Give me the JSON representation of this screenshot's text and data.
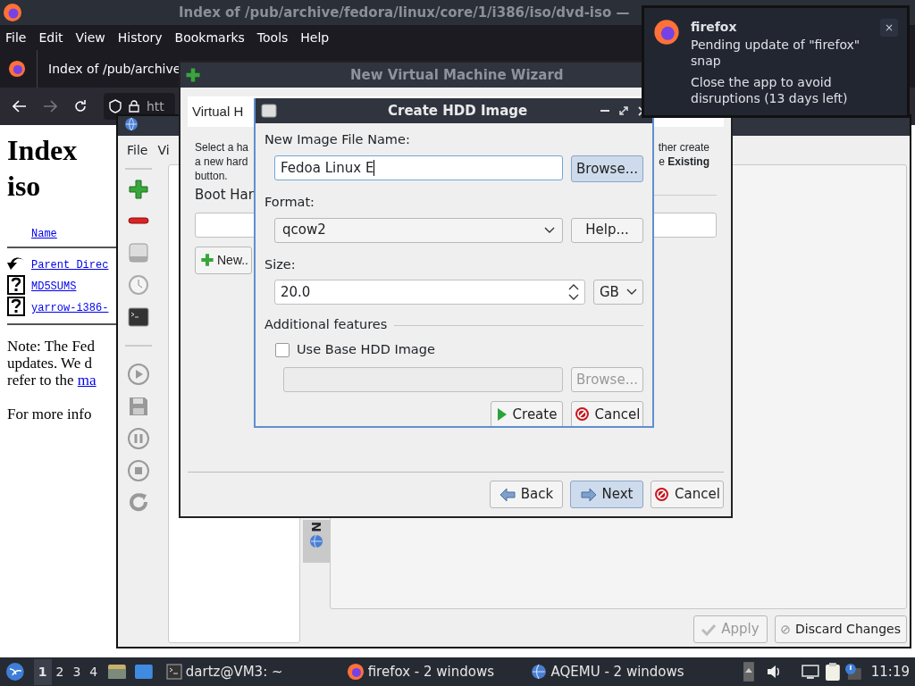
{
  "browser": {
    "title": "Index of /pub/archive/fedora/linux/core/1/i386/iso/dvd-iso —",
    "menu": [
      "File",
      "Edit",
      "View",
      "History",
      "Bookmarks",
      "Tools",
      "Help"
    ],
    "tab": "Index of /pub/archive",
    "address": "htt",
    "page": {
      "heading": [
        "Index",
        "iso"
      ],
      "column": "Name",
      "rows": [
        {
          "kind": "back",
          "name": "Parent Direc"
        },
        {
          "kind": "unknown",
          "name": "MD5SUMS"
        },
        {
          "kind": "unknown",
          "name": "yarrow-i386-"
        }
      ],
      "note": [
        "Note: The Fed",
        "updates. We d",
        "refer to the"
      ],
      "note_link": "ma",
      "more": "For more info"
    }
  },
  "aqemu": {
    "menu": [
      "File",
      "Vi"
    ],
    "side_tab": "N",
    "buttons": [
      {
        "kind": "apply",
        "label": "Apply",
        "disabled": true
      },
      {
        "kind": "discard",
        "label": "Discard Changes",
        "disabled": false
      }
    ]
  },
  "wizard": {
    "title": "New Virtual Machine Wizard",
    "header": "Virtual H",
    "intro_left": [
      "Select a ha",
      "a new hard",
      "button."
    ],
    "intro_right": [
      "ther create",
      "e **Existing**"
    ],
    "group": "Boot Har",
    "new_button": "New..",
    "buttons": [
      {
        "kind": "back",
        "label": "Back",
        "default": false
      },
      {
        "kind": "next",
        "label": "Next",
        "default": true
      },
      {
        "kind": "cancel",
        "label": "Cancel",
        "default": false
      }
    ]
  },
  "hdd_dialog": {
    "title": "Create HDD Image",
    "name_label": "New Image File Name:",
    "name_value": "Fedoa Linux E",
    "name_focused": true,
    "browse": {
      "label": "Browse...",
      "highlighted": true
    },
    "format_label": "Format:",
    "format": "qcow2",
    "help": "Help...",
    "size_label": "Size:",
    "size": "20.0",
    "unit": "GB",
    "group": "Additional features",
    "base_image": {
      "label": "Use Base HDD Image",
      "checked": false
    },
    "base_path": {
      "disabled": true
    },
    "base_browse": {
      "label": "Browse...",
      "disabled": true
    },
    "buttons": [
      {
        "kind": "create",
        "label": "Create"
      },
      {
        "kind": "cancel",
        "label": "Cancel"
      }
    ]
  },
  "notification": {
    "app": "firefox",
    "close": "×",
    "lines": [
      "Pending update of \"firefox\" snap",
      "Close the app to avoid disruptions (13 days left)"
    ]
  },
  "taskbar": {
    "workspaces": [
      {
        "label": "1",
        "selected": true
      },
      {
        "label": "2",
        "selected": false
      },
      {
        "label": "3",
        "selected": false
      },
      {
        "label": "4",
        "selected": false
      }
    ],
    "tasks": [
      {
        "kind": "terminal",
        "label": "dartz@VM3: ~"
      },
      {
        "kind": "firefox",
        "label": "firefox - 2 windows"
      },
      {
        "kind": "aqemu",
        "label": "AQEMU - 2 windows"
      }
    ],
    "clock": "11:19"
  }
}
